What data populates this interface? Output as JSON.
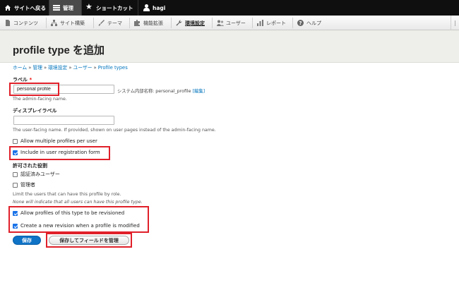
{
  "toolbar": {
    "back_label": "サイトへ戻る",
    "manage_label": "管理",
    "shortcut_label": "ショートカット",
    "user_label": "hagi"
  },
  "menu": {
    "items": [
      {
        "label": "コンテンツ",
        "icon": "document-icon"
      },
      {
        "label": "サイト構築",
        "icon": "structure-icon"
      },
      {
        "label": "テーマ",
        "icon": "brush-icon"
      },
      {
        "label": "機能拡張",
        "icon": "puzzle-icon"
      },
      {
        "label": "環境設定",
        "icon": "wrench-icon"
      },
      {
        "label": "ユーザー",
        "icon": "people-icon"
      },
      {
        "label": "レポート",
        "icon": "chart-icon"
      },
      {
        "label": "ヘルプ",
        "icon": "help-icon"
      }
    ],
    "active": "環境設定"
  },
  "page": {
    "title": "profile type を追加"
  },
  "breadcrumb": [
    "ホーム",
    "管理",
    "環境設定",
    "ユーザー",
    "Profile types"
  ],
  "breadcrumb_sep": "»",
  "form": {
    "label_title": "ラベル",
    "required_mark": "*",
    "label_value": "personal profile",
    "machine_prefix": "システム内部名称: personal_profile",
    "machine_edit": "[編集]",
    "label_desc": "The admin-facing name.",
    "display_title": "ディスプレイラベル",
    "display_value": "",
    "display_desc": "The user-facing name. If provided, shown on user pages instead of the admin-facing name.",
    "multiple_label": "Allow multiple profiles per user",
    "multiple_checked": false,
    "registration_label": "Include in user registration form",
    "registration_checked": true,
    "roles_title": "許可された役割",
    "role_authenticated": "認証済みユーザー",
    "role_admin": "管理者",
    "roles_desc": "Limit the users that can have this profile by role.",
    "roles_desc2": "None will indicate that all users can have this profile type.",
    "revision_label": "Allow profiles of this type to be revisioned",
    "revision_checked": true,
    "new_revision_label": "Create a new revision when a profile is modified",
    "new_revision_checked": true,
    "save_label": "保存",
    "save_manage_label": "保存してフィールドを管理"
  },
  "colors": {
    "accent": "#0f73c6",
    "highlight": "#e0202a",
    "link": "#0074bd"
  }
}
